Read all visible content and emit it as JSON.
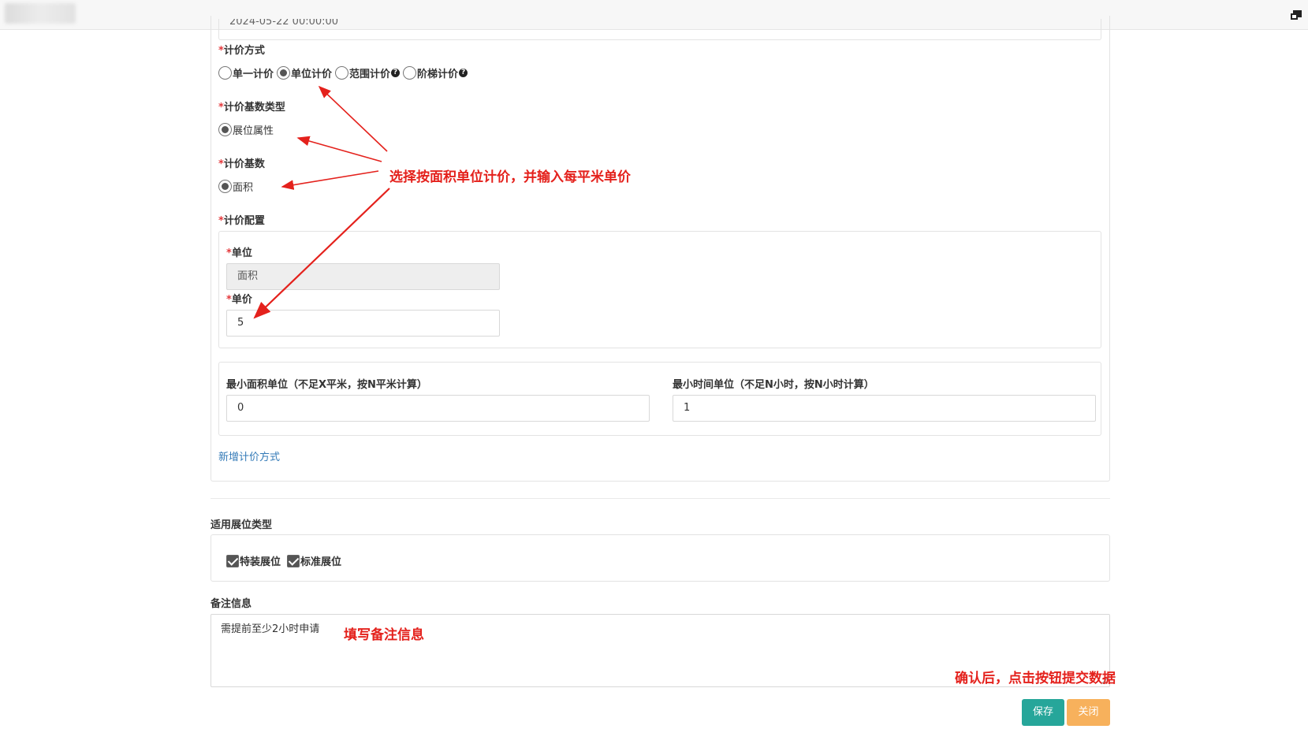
{
  "top_field": {
    "value": "2024-05-22 00:00:00"
  },
  "pricing_method": {
    "label": "计价方式",
    "options": [
      {
        "label": "单一计价",
        "checked": false
      },
      {
        "label": "单位计价",
        "checked": true
      },
      {
        "label": "范围计价",
        "checked": false,
        "help_icon": "question-circle-icon"
      },
      {
        "label": "阶梯计价",
        "checked": false,
        "help_icon": "question-circle-icon"
      }
    ]
  },
  "base_type": {
    "label": "计价基数类型",
    "option": "展位属性"
  },
  "base": {
    "label": "计价基数",
    "option": "面积"
  },
  "config": {
    "label": "计价配置",
    "unit_label": "单位",
    "unit_value": "面积",
    "price_label": "单价",
    "price_value": "5"
  },
  "minimums": {
    "area_label": "最小面积单位（不足X平米，按N平米计算）",
    "area_value": "0",
    "time_label": "最小时间单位（不足N小时，按N小时计算）",
    "time_value": "1"
  },
  "add_method_link": "新增计价方式",
  "booth_types": {
    "label": "适用展位类型",
    "items": [
      {
        "label": "特装展位",
        "checked": true
      },
      {
        "label": "标准展位",
        "checked": true
      }
    ]
  },
  "remarks": {
    "label": "备注信息",
    "value": "需提前至少2小时申请"
  },
  "buttons": {
    "save": "保存",
    "close": "关闭"
  },
  "annotations": {
    "pricing": "选择按面积单位计价，并输入每平米单价",
    "remark": "填写备注信息",
    "submit": "确认后，点击按钮提交数据",
    "color": "#e4211c"
  },
  "colors": {
    "save": "#26a69a",
    "close": "#f7b15c",
    "required": "#e4393c",
    "link": "#337ab7"
  },
  "icons": {
    "window": "restore-window-icon"
  }
}
